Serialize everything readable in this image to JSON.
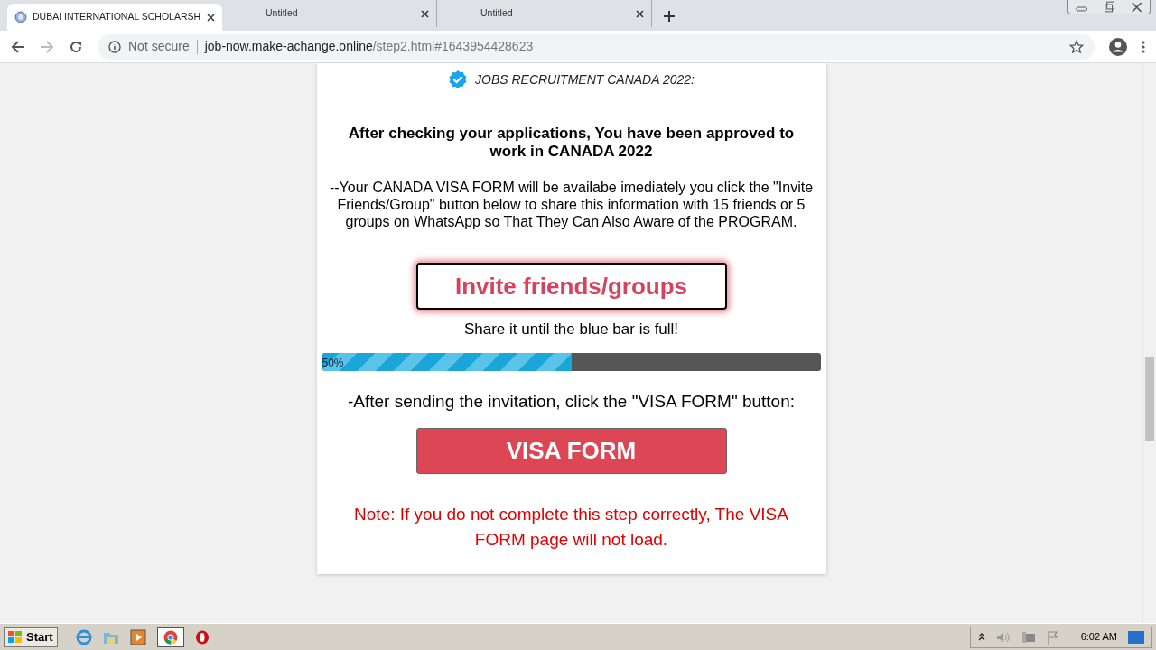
{
  "tabs": [
    {
      "title": "DUBAI INTERNATIONAL SCHOLARSH",
      "selected": true
    },
    {
      "title": "Untitled",
      "selected": false
    },
    {
      "title": "Untitled",
      "selected": false
    }
  ],
  "address_bar": {
    "security": "Not secure",
    "url_host": "job-now.make-achange.online",
    "url_path": "/step2.html#1643954428623"
  },
  "page": {
    "badge_text": "JOBS RECRUITMENT CANADA 2022:",
    "headline": "After checking your applications, You have been approved to work in CANADA 2022",
    "instructions": "--Your CANADA VISA FORM will be availabe imediately you click the \"Invite Friends/Group\" button below to share this information with 15 friends or 5 groups on WhatsApp so That They Can Also Aware of the PROGRAM.",
    "invite_button": "Invite friends/groups",
    "share_hint": "Share it until the blue bar is full!",
    "progress": {
      "level": 0.5,
      "label": "50%"
    },
    "after_text": "-After sending the invitation, click the \"VISA FORM\" button:",
    "visa_button": "VISA FORM",
    "note": "Note: If you do not complete this step correctly, The VISA FORM page will not load."
  },
  "taskbar": {
    "start": "Start",
    "clock": "6:02 AM"
  }
}
